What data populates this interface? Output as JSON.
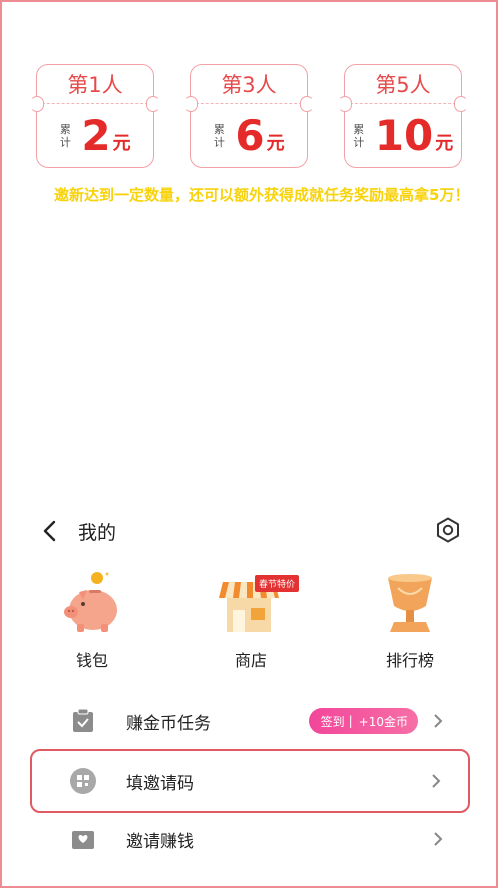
{
  "tickets": [
    {
      "title": "第1人",
      "accum": "累计",
      "amount": "2",
      "unit": "元"
    },
    {
      "title": "第3人",
      "accum": "累计",
      "amount": "6",
      "unit": "元"
    },
    {
      "title": "第5人",
      "accum": "累计",
      "amount": "10",
      "unit": "元"
    }
  ],
  "bonus_text": "邀新达到一定数量，还可以额外获得成就任务奖励最高拿5万！",
  "me": {
    "title": "我的"
  },
  "shortcuts": [
    {
      "label": "钱包"
    },
    {
      "label": "商店",
      "tag": "春节特价"
    },
    {
      "label": "排行榜"
    }
  ],
  "rows": [
    {
      "label": "赚金币任务",
      "badge_left": "签到",
      "badge_right": "+10金币"
    },
    {
      "label": "填邀请码"
    },
    {
      "label": "邀请赚钱"
    }
  ],
  "colors": {
    "accent_red": "#e52a2a",
    "highlight_border": "#e05a64",
    "bonus_yellow": "#f8d20a",
    "badge_pink": "#f2469a"
  }
}
